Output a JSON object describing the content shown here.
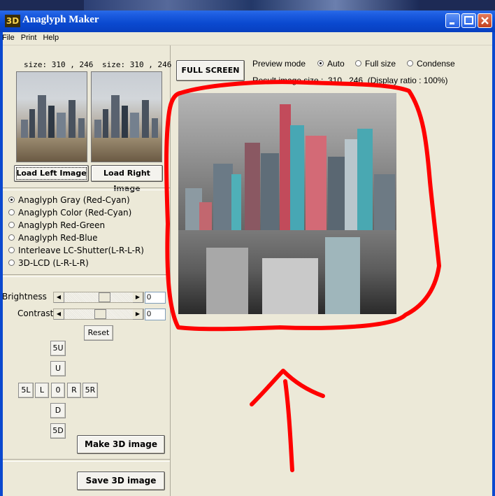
{
  "window": {
    "icon_text": "3D",
    "title": "Anaglyph Maker",
    "min": "_",
    "max": "□",
    "close": "X"
  },
  "menu": [
    "File",
    "Print",
    "Help"
  ],
  "left": {
    "left_size": "size: 310 , 246",
    "right_size": "size: 310 , 246",
    "load_left": "Load Left Image",
    "load_right": "Load Right Image",
    "modes": [
      {
        "label": "Anaglyph Gray (Red-Cyan)",
        "selected": true
      },
      {
        "label": "Anaglyph Color (Red-Cyan)",
        "selected": false
      },
      {
        "label": "Anaglyph Red-Green",
        "selected": false
      },
      {
        "label": "Anaglyph Red-Blue",
        "selected": false
      },
      {
        "label": "Interleave LC-Shutter(L-R-L-R)",
        "selected": false
      },
      {
        "label": "3D-LCD (L-R-L-R)",
        "selected": false
      }
    ],
    "brightness_label": "Brightness",
    "brightness_value": "0",
    "contrast_label": "Contrast",
    "contrast_value": "0",
    "reset": "Reset",
    "nudge": {
      "up5": "5U",
      "up": "U",
      "left5": "5L",
      "left": "L",
      "zero": "0",
      "right": "R",
      "right5": "5R",
      "down": "D",
      "down5": "5D"
    },
    "make": "Make 3D image",
    "save": "Save 3D image"
  },
  "right": {
    "fullscreen": "FULL SCREEN",
    "preview_mode_label": "Preview mode",
    "preview_modes": [
      {
        "label": "Auto",
        "selected": true
      },
      {
        "label": "Full size",
        "selected": false
      },
      {
        "label": "Condense",
        "selected": false
      }
    ],
    "result_label": "Result image size :",
    "result_size": "310 , 246",
    "display_ratio": "(Display ratio : 100%)"
  },
  "annotation_color": "#ff0000"
}
